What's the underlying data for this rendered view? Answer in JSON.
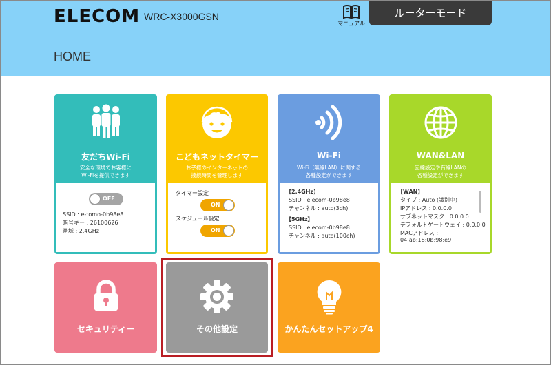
{
  "header": {
    "logo": "ELECOM",
    "model": "WRC-X3000GSN",
    "manual_label": "マニュアル",
    "mode_button": "ルーターモード",
    "page_title": "HOME"
  },
  "tiles": {
    "friends": {
      "title": "友だちWi-Fi",
      "desc": "安全な環境でお客様に\nWi-Fiを提供できます",
      "toggle": "OFF",
      "ssid": "SSID : e-tomo-0b98e8",
      "key": "暗号キー : 26100626",
      "band": "帯域 : 2.4GHz"
    },
    "kids": {
      "title": "こどもネットタイマー",
      "desc": "お子様のインターネットの\n接続時間を管理します",
      "timer_label": "タイマー設定",
      "timer_toggle": "ON",
      "schedule_label": "スケジュール設定",
      "schedule_toggle": "ON"
    },
    "wifi": {
      "title": "Wi-Fi",
      "desc": "Wi-Fi（無線LAN）に関する\n各種設定ができます",
      "band24": "【2.4GHz】",
      "ssid24": "SSID : elecom-0b98e8",
      "ch24": "チャンネル : auto(3ch)",
      "band5": "【5GHz】",
      "ssid5": "SSID : elecom-0b98e8",
      "ch5": "チャンネル : auto(100ch)"
    },
    "wan": {
      "title": "WAN&LAN",
      "desc": "回線設定や有線LANの\n各種設定ができます",
      "heading": "【WAN】",
      "type": "タイプ : Auto (識別中)",
      "ip": "IPアドレス : 0.0.0.0",
      "mask": "サブネットマスク : 0.0.0.0",
      "gateway": "デフォルトゲートウェイ : 0.0.0.0",
      "mac_label": "MACアドレス :",
      "mac": "04:ab:18:0b:98:e9"
    },
    "security": {
      "title": "セキュリティー"
    },
    "other": {
      "title": "その他設定"
    },
    "setup": {
      "title": "かんたんセットアップ4"
    }
  },
  "icons": {
    "manual": "book-icon",
    "friends": "people-icon",
    "kids": "child-face-icon",
    "wifi": "wifi-signal-icon",
    "wan": "globe-icon",
    "security": "lock-icon",
    "other": "gear-icon",
    "setup": "lightbulb-icon"
  },
  "colors": {
    "header_bg": "#87d2f9",
    "friends": "#33bdba",
    "kids": "#fcc800",
    "wifi": "#6b9de0",
    "wan": "#a8d82a",
    "security": "#ee7a8c",
    "other": "#9a9a9a",
    "setup": "#fba31f",
    "highlight": "#b91e24"
  }
}
